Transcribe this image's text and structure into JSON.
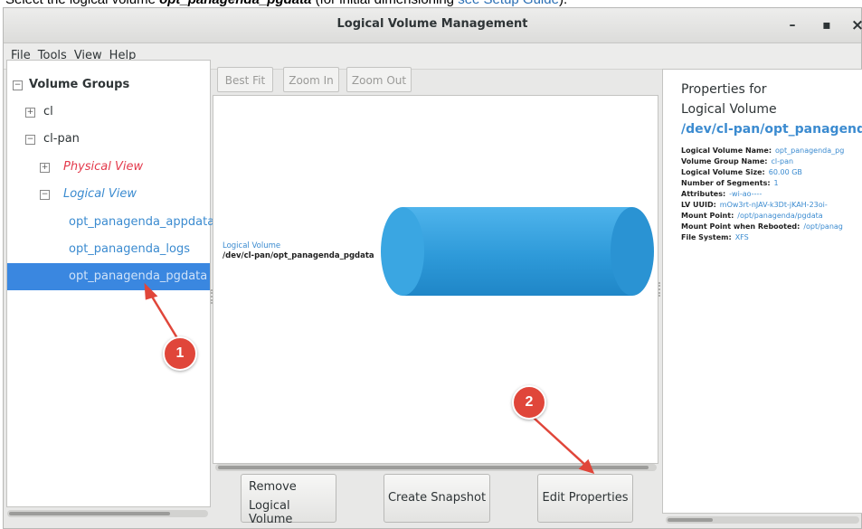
{
  "caption": {
    "prefix": "Select the logical volume ",
    "volume": "opt_panagenda_pgdata",
    "middle": " (for initial dimensioning ",
    "link": "see Setup Guide",
    "suffix": ")."
  },
  "window": {
    "title": "Logical Volume Management",
    "minimize_glyph": "–",
    "maximize_glyph": "▪",
    "close_glyph": "×"
  },
  "menu": [
    {
      "label": "File",
      "key": "F",
      "rest": "ile"
    },
    {
      "label": "Tools",
      "key": "T",
      "rest": "ools"
    },
    {
      "label": "View",
      "key": "V",
      "rest": "iew"
    },
    {
      "label": "Help",
      "key": "H",
      "rest": "elp"
    }
  ],
  "tree": {
    "root": "Volume Groups",
    "groups": [
      "cl",
      "cl-pan"
    ],
    "physical_view": "Physical View",
    "logical_view": "Logical View",
    "volumes": [
      "opt_panagenda_appdata",
      "opt_panagenda_logs",
      "opt_panagenda_pgdata"
    ],
    "collapse_glyph": "−",
    "expand_glyph": "+"
  },
  "toolbar": {
    "best_fit": "Best Fit",
    "zoom_in": "Zoom In",
    "zoom_out": "Zoom Out"
  },
  "diagram": {
    "caption_type": "Logical Volume",
    "caption_path": "/dev/cl-pan/opt_panagenda_pgdata",
    "cylinder_color": "#2e9ad9"
  },
  "actions": {
    "remove_line1": "Remove",
    "remove_line2": "Logical Volume",
    "snapshot": "Create Snapshot",
    "edit": "Edit Properties"
  },
  "properties": {
    "heading1": "Properties for",
    "heading2": "Logical Volume",
    "path": "/dev/cl-pan/opt_panagenda",
    "rows": [
      {
        "key": "Logical Volume Name:",
        "value": "opt_panagenda_pg"
      },
      {
        "key": "Volume Group Name:",
        "value": "cl-pan"
      },
      {
        "key": "Logical Volume Size:",
        "value": "60.00 GB"
      },
      {
        "key": "Number of Segments:",
        "value": "1"
      },
      {
        "key": "Attributes:",
        "value": "-wi-ao----"
      },
      {
        "key": "LV UUID:",
        "value": "mOw3rt-nJAV-k3Dt-jKAH-23oi-"
      },
      {
        "key": "Mount Point:",
        "value": "/opt/panagenda/pgdata"
      },
      {
        "key": "Mount Point when Rebooted:",
        "value": "/opt/panag"
      },
      {
        "key": "File System:",
        "value": "XFS"
      }
    ]
  },
  "annotations": {
    "badge1": "1",
    "badge2": "2",
    "color": "#e0463a"
  }
}
